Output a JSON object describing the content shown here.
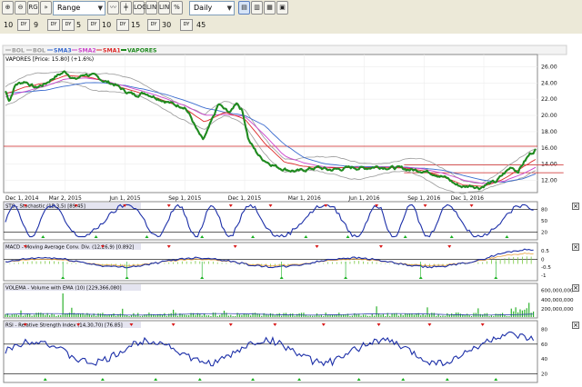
{
  "toolbar": {
    "tools": [
      "zoom-in-icon",
      "zoom-out-icon",
      "range-icon",
      "range-select-icon",
      "line-icon",
      "bar-icon",
      "candle-icon",
      "log-scale-icon",
      "linear-icon",
      "lin-scale-icon",
      "percent-icon",
      "layout-1-icon",
      "layout-2-icon",
      "layout-3-icon",
      "layout-4-icon",
      "close-icon"
    ],
    "range_value": "Range",
    "interval_value": "Daily",
    "tool_labels": {
      "log": "LOG",
      "lin": "LIN",
      "lin2": "LIN",
      "pct": "%",
      "rg": "RG"
    }
  },
  "presets": [
    {
      "value": "10",
      "unit": "DY"
    },
    {
      "value": "9",
      "unit": "DY"
    },
    {
      "value": "5",
      "unit": "DY"
    },
    {
      "value": "10",
      "unit": "DY"
    },
    {
      "value": "15",
      "unit": "DY"
    },
    {
      "value": "30",
      "unit": "DY"
    },
    {
      "value": "45",
      "unit": "DY"
    }
  ],
  "legend": [
    "BOL",
    "BOL",
    "SMA3",
    "SMA2",
    "SMA1",
    "VAPORES"
  ],
  "colors": {
    "price": "#1f8a1f",
    "bol": "#9a9a9a",
    "sma3": "#3b6ccf",
    "sma2": "#cc44cc",
    "sma1": "#dd2a2a",
    "hline": "#cc2222",
    "ind": "#1c2fa8",
    "buy": "#18b020",
    "sell": "#d81818",
    "volume": "#2db22d",
    "macd_signal": "#e8a03a",
    "hist": "#7ac943"
  },
  "chart_data": {
    "type": "line",
    "title": "VAPORES [Price: 15.80] (+1.6%)",
    "x_ticks": [
      "Dec 1, 2014",
      "Mar 2, 2015",
      "Jun 1, 2015",
      "Sep 1, 2015",
      "Dec 1, 2015",
      "Mar 1, 2016",
      "Jun 1, 2016",
      "Sep 1, 2016",
      "Dec 1, 2016"
    ],
    "ylim": [
      10.5,
      27.5
    ],
    "y_ticks": [
      12.0,
      14.0,
      16.0,
      18.0,
      20.0,
      22.0,
      24.0,
      26.0
    ],
    "reference_lines": [
      16.2
    ],
    "support_lines": [
      {
        "from": 20,
        "to": 28,
        "value": 13.9
      },
      {
        "from": 20,
        "to": 28,
        "value": 12.95
      }
    ],
    "price_knots": [
      [
        0,
        23.0
      ],
      [
        0.2,
        21.8
      ],
      [
        0.5,
        23.8
      ],
      [
        1.0,
        24.2
      ],
      [
        1.5,
        23.4
      ],
      [
        2.0,
        23.9
      ],
      [
        2.5,
        24.8
      ],
      [
        3.0,
        25.4
      ],
      [
        3.5,
        24.4
      ],
      [
        4.0,
        25.1
      ],
      [
        4.5,
        24.8
      ],
      [
        5.0,
        24.2
      ],
      [
        5.5,
        23.8
      ],
      [
        6.0,
        23.0
      ],
      [
        6.5,
        22.5
      ],
      [
        7.0,
        22.8
      ],
      [
        7.5,
        22.3
      ],
      [
        8.0,
        21.8
      ],
      [
        8.5,
        21.3
      ],
      [
        9.0,
        21.1
      ],
      [
        9.3,
        19.8
      ],
      [
        9.6,
        18.2
      ],
      [
        9.9,
        16.9
      ],
      [
        10.1,
        17.8
      ],
      [
        10.4,
        19.6
      ],
      [
        10.7,
        21.4
      ],
      [
        11.0,
        20.7
      ],
      [
        11.3,
        20.4
      ],
      [
        11.6,
        21.7
      ],
      [
        11.9,
        20.5
      ],
      [
        12.2,
        17.0
      ],
      [
        12.5,
        15.8
      ],
      [
        12.8,
        14.8
      ],
      [
        13.2,
        14.2
      ],
      [
        13.7,
        13.6
      ],
      [
        14.2,
        13.3
      ],
      [
        14.7,
        13.1
      ],
      [
        15.2,
        13.4
      ],
      [
        15.7,
        13.6
      ],
      [
        16.2,
        13.3
      ],
      [
        16.8,
        13.4
      ],
      [
        17.4,
        13.6
      ],
      [
        18.0,
        13.5
      ],
      [
        18.6,
        13.7
      ],
      [
        19.2,
        13.6
      ],
      [
        19.8,
        13.5
      ],
      [
        20.4,
        13.3
      ],
      [
        21.0,
        13.2
      ],
      [
        21.6,
        12.8
      ],
      [
        22.2,
        12.2
      ],
      [
        22.6,
        11.5
      ],
      [
        23.0,
        11.2
      ],
      [
        23.4,
        11.4
      ],
      [
        23.8,
        11.1
      ],
      [
        24.2,
        11.6
      ],
      [
        24.6,
        11.8
      ],
      [
        25.0,
        12.8
      ],
      [
        25.4,
        13.7
      ],
      [
        25.7,
        13.1
      ],
      [
        26.0,
        14.2
      ],
      [
        26.3,
        15.2
      ],
      [
        26.6,
        15.8
      ]
    ],
    "sma1_knots": [
      [
        0,
        22.6
      ],
      [
        1,
        23.5
      ],
      [
        2,
        24.0
      ],
      [
        3,
        24.9
      ],
      [
        4,
        24.8
      ],
      [
        5,
        24.2
      ],
      [
        6,
        23.3
      ],
      [
        7,
        22.6
      ],
      [
        8,
        21.8
      ],
      [
        9,
        20.8
      ],
      [
        10,
        19.2
      ],
      [
        11,
        20.4
      ],
      [
        12,
        19.6
      ],
      [
        13,
        16.6
      ],
      [
        14,
        14.2
      ],
      [
        15,
        13.7
      ],
      [
        16,
        13.5
      ],
      [
        17,
        13.6
      ],
      [
        18,
        13.6
      ],
      [
        19,
        13.6
      ],
      [
        20,
        13.5
      ],
      [
        21,
        13.2
      ],
      [
        22,
        12.4
      ],
      [
        23,
        11.4
      ],
      [
        24,
        11.3
      ],
      [
        25,
        12.2
      ],
      [
        26,
        13.7
      ],
      [
        26.6,
        14.6
      ]
    ],
    "sma2_knots": [
      [
        0,
        22.3
      ],
      [
        1,
        23.0
      ],
      [
        2,
        23.6
      ],
      [
        3,
        24.5
      ],
      [
        4,
        24.6
      ],
      [
        5,
        24.3
      ],
      [
        6,
        23.6
      ],
      [
        7,
        22.9
      ],
      [
        8,
        22.1
      ],
      [
        9,
        21.2
      ],
      [
        10,
        20.0
      ],
      [
        11,
        20.1
      ],
      [
        12,
        19.9
      ],
      [
        13,
        17.6
      ],
      [
        14,
        15.0
      ],
      [
        15,
        14.1
      ],
      [
        16,
        13.7
      ],
      [
        17,
        13.6
      ],
      [
        18,
        13.6
      ],
      [
        19,
        13.6
      ],
      [
        20,
        13.6
      ],
      [
        21,
        13.4
      ],
      [
        22,
        12.9
      ],
      [
        23,
        12.0
      ],
      [
        24,
        11.6
      ],
      [
        25,
        11.9
      ],
      [
        26,
        12.9
      ],
      [
        26.6,
        13.6
      ]
    ],
    "sma3_knots": [
      [
        0,
        22.8
      ],
      [
        1,
        22.9
      ],
      [
        2,
        23.1
      ],
      [
        3,
        23.6
      ],
      [
        4,
        24.0
      ],
      [
        5,
        24.0
      ],
      [
        6,
        23.7
      ],
      [
        7,
        23.2
      ],
      [
        8,
        22.6
      ],
      [
        9,
        21.8
      ],
      [
        10,
        20.9
      ],
      [
        11,
        20.4
      ],
      [
        12,
        20.0
      ],
      [
        13,
        18.8
      ],
      [
        14,
        16.4
      ],
      [
        15,
        14.8
      ],
      [
        16,
        14.1
      ],
      [
        17,
        13.8
      ],
      [
        18,
        13.7
      ],
      [
        19,
        13.7
      ],
      [
        20,
        13.6
      ],
      [
        21,
        13.5
      ],
      [
        22,
        13.2
      ],
      [
        23,
        12.6
      ],
      [
        24,
        12.0
      ],
      [
        25,
        11.8
      ],
      [
        26,
        12.2
      ],
      [
        26.6,
        12.8
      ]
    ],
    "series": [
      {
        "name": "VAPORES",
        "type": "price"
      },
      {
        "name": "SMA1",
        "type": "sma"
      },
      {
        "name": "SMA2",
        "type": "sma"
      },
      {
        "name": "SMA3",
        "type": "sma"
      },
      {
        "name": "BOL",
        "type": "band"
      }
    ],
    "panels": [
      {
        "id": "sts",
        "label": "STS - Stochastic (15,3,5) [89.45]",
        "y_ticks": [
          "80",
          "50",
          "20"
        ]
      },
      {
        "id": "macd",
        "label": "MACD - Moving Average Conv. Div. (12,26,9) [0.892]",
        "y_ticks": [
          "0.5",
          "0",
          "-0.5",
          "-1"
        ]
      },
      {
        "id": "volema",
        "label": "VOLEMA - Volume with EMA (10) [229,366,080]",
        "y_ticks": [
          "600,000,000",
          "400,000,000",
          "200,000,000"
        ]
      },
      {
        "id": "rsi",
        "label": "RSI - Relative Strength Index (14,30,70) [76.85]",
        "y_ticks": [
          "80",
          "60",
          "40",
          "20"
        ]
      }
    ]
  }
}
